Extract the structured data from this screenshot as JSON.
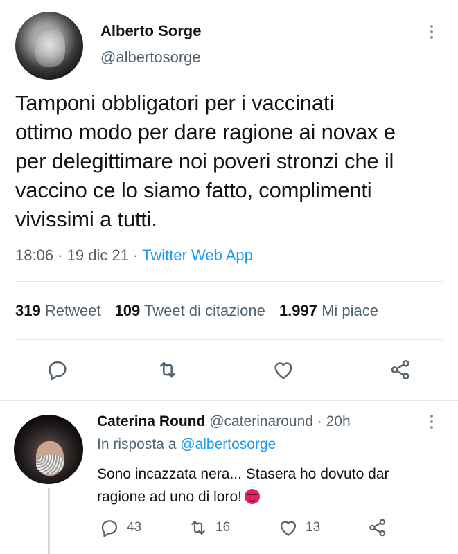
{
  "tweet": {
    "author_name": "Alberto Sorge",
    "author_handle": "@albertosorge",
    "text_lines": [
      "Tamponi obbligatori per i vaccinati",
      "ottimo modo per dare ragione ai novax e",
      "per delegittimare noi poveri stronzi che il",
      "vaccino ce lo siamo fatto, complimenti",
      "vivissimi a tutti."
    ],
    "time": "18:06",
    "sep": "·",
    "date": "19 dic 21",
    "source": "Twitter Web App",
    "retweets_count": "319",
    "retweets_label": "Retweet",
    "quotes_count": "109",
    "quotes_label": "Tweet di citazione",
    "likes_count": "1.997",
    "likes_label": "Mi piace"
  },
  "reply": {
    "author_name": "Caterina Round",
    "author_handle": "@caterinaround",
    "sep": "·",
    "time_ago": "20h",
    "reply_to_prefix": "In risposta a",
    "reply_to_handle": "@albertosorge",
    "text_line1": "Sono incazzata nera... Stasera ho dovuto dar",
    "text_line2": "ragione ad uno di loro!",
    "emoji": "angry-face-emoji",
    "reply_count": "43",
    "retweet_count": "16",
    "like_count": "13"
  },
  "colors": {
    "text": "#0f1419",
    "secondary": "#536471",
    "link": "#1d9bf0",
    "divider": "#e1e6ea",
    "emoji": "#e0245e"
  }
}
